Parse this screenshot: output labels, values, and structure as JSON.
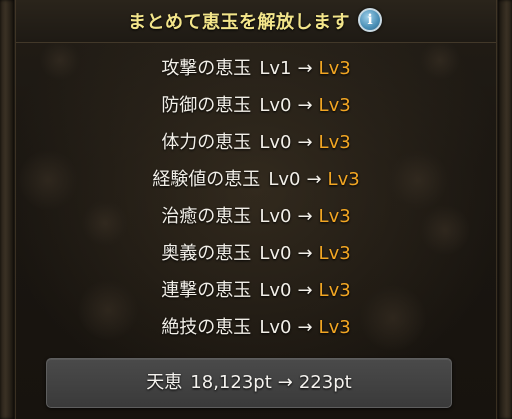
{
  "dialog": {
    "title": "まとめて恵玉を解放します",
    "info_icon": "info-icon"
  },
  "upgrades": [
    {
      "name": "攻撃の恵玉",
      "from": "Lv1",
      "to": "Lv3"
    },
    {
      "name": "防御の恵玉",
      "from": "Lv0",
      "to": "Lv3"
    },
    {
      "name": "体力の恵玉",
      "from": "Lv0",
      "to": "Lv3"
    },
    {
      "name": "経験値の恵玉",
      "from": "Lv0",
      "to": "Lv3"
    },
    {
      "name": "治癒の恵玉",
      "from": "Lv0",
      "to": "Lv3"
    },
    {
      "name": "奥義の恵玉",
      "from": "Lv0",
      "to": "Lv3"
    },
    {
      "name": "連撃の恵玉",
      "from": "Lv0",
      "to": "Lv3"
    },
    {
      "name": "絶技の恵玉",
      "from": "Lv0",
      "to": "Lv3"
    }
  ],
  "arrow": "→",
  "cost": {
    "label": "天恵",
    "from": "18,123pt",
    "to": "223pt"
  },
  "colors": {
    "title": "#f3e58a",
    "level_target": "#f2a623",
    "text": "#f2efe8",
    "info_icon": "#4a8fb6"
  }
}
